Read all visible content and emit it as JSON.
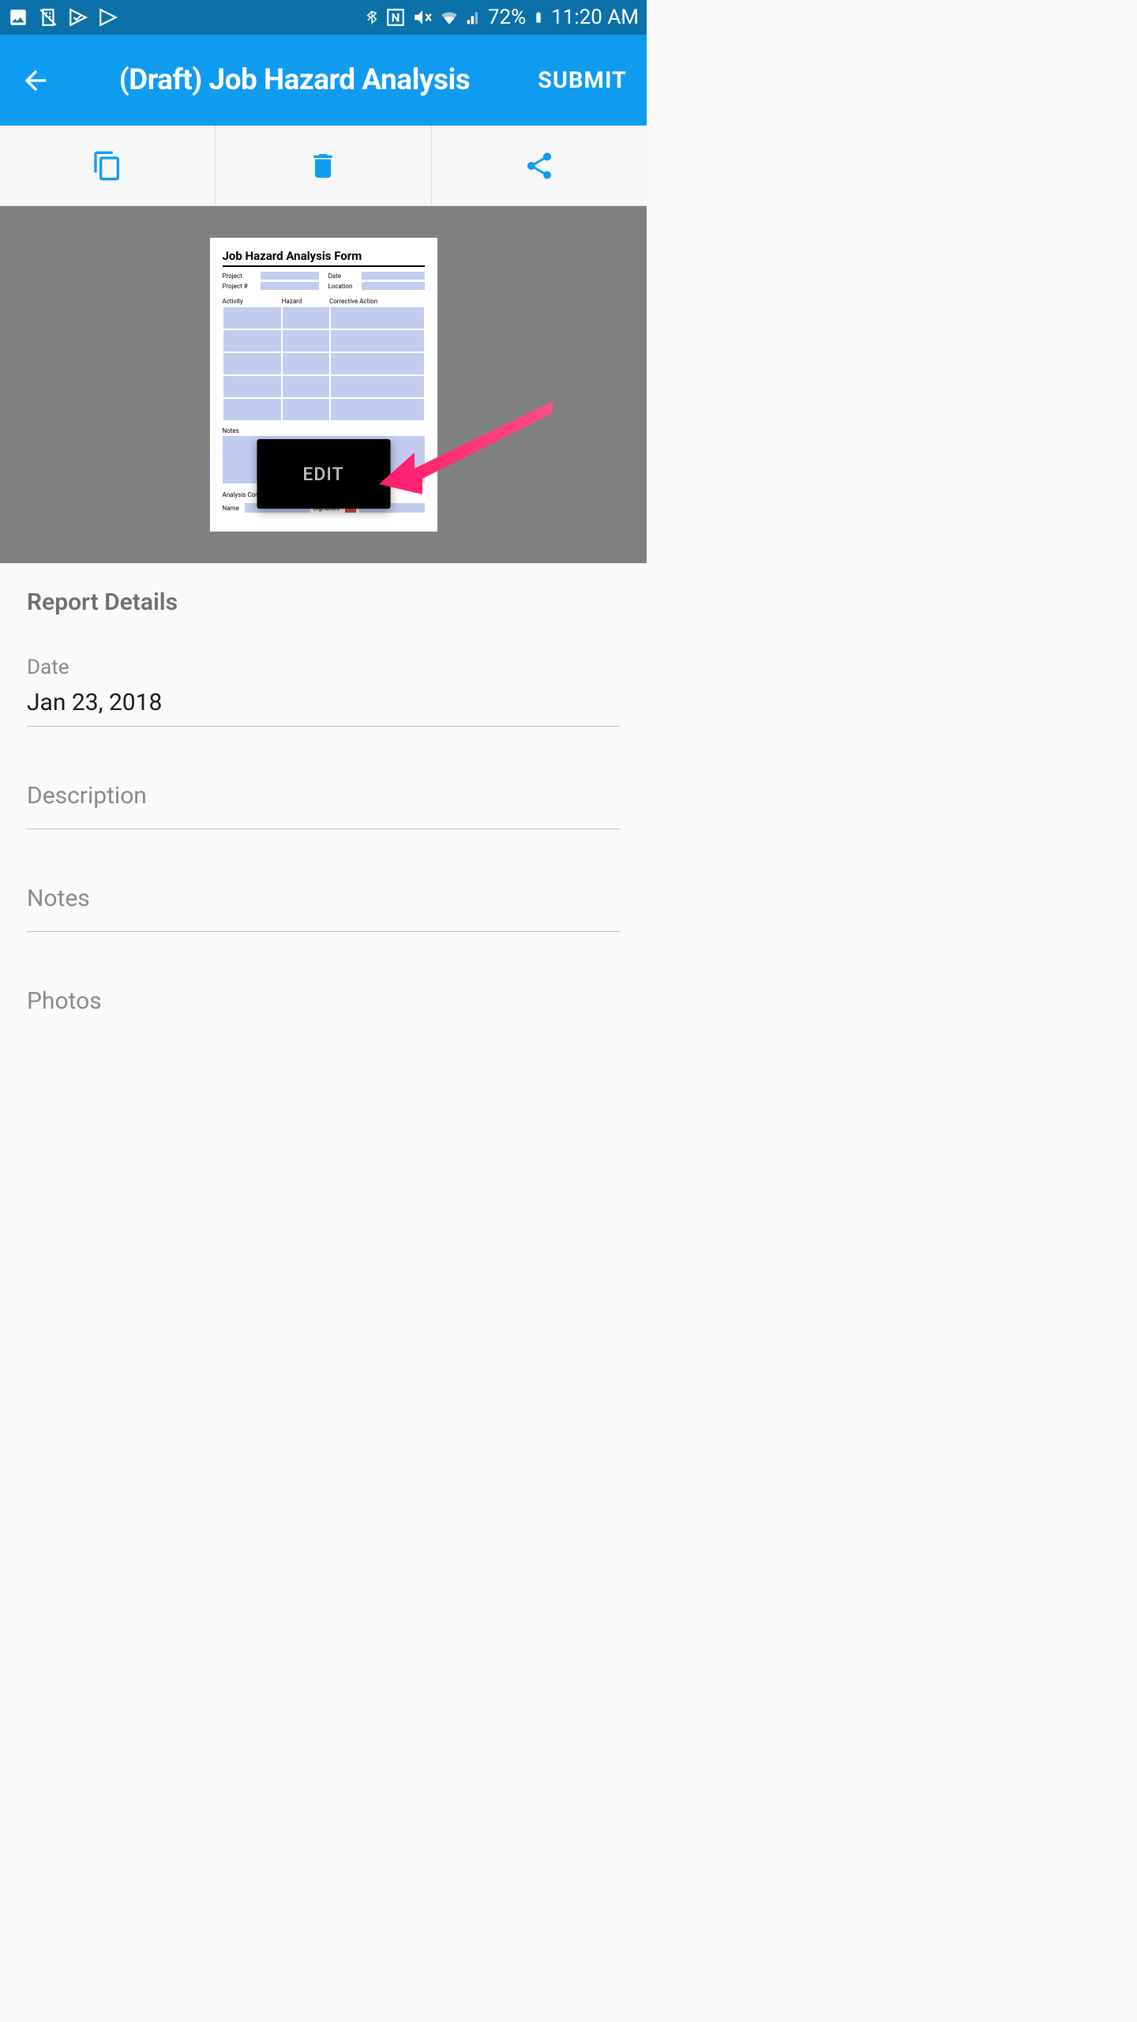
{
  "status_bar": {
    "battery_percent": "72%",
    "time": "11:20 AM"
  },
  "app_bar": {
    "title": "(Draft) Job Hazard Analysis",
    "submit_label": "SUBMIT"
  },
  "preview": {
    "form_title": "Job Hazard Analysis Form",
    "labels": {
      "project": "Project",
      "project_num": "Project #",
      "date": "Date",
      "location": "Location",
      "activity": "Activity",
      "hazard": "Hazard",
      "corrective": "Corrective Action",
      "notes": "Notes",
      "analysis": "Analysis Comp",
      "name": "Name",
      "signature": "Signature"
    },
    "edit_label": "EDIT"
  },
  "details": {
    "section_title": "Report Details",
    "date_label": "Date",
    "date_value": "Jan 23, 2018",
    "description_label": "Description",
    "notes_label": "Notes",
    "photos_label": "Photos"
  }
}
